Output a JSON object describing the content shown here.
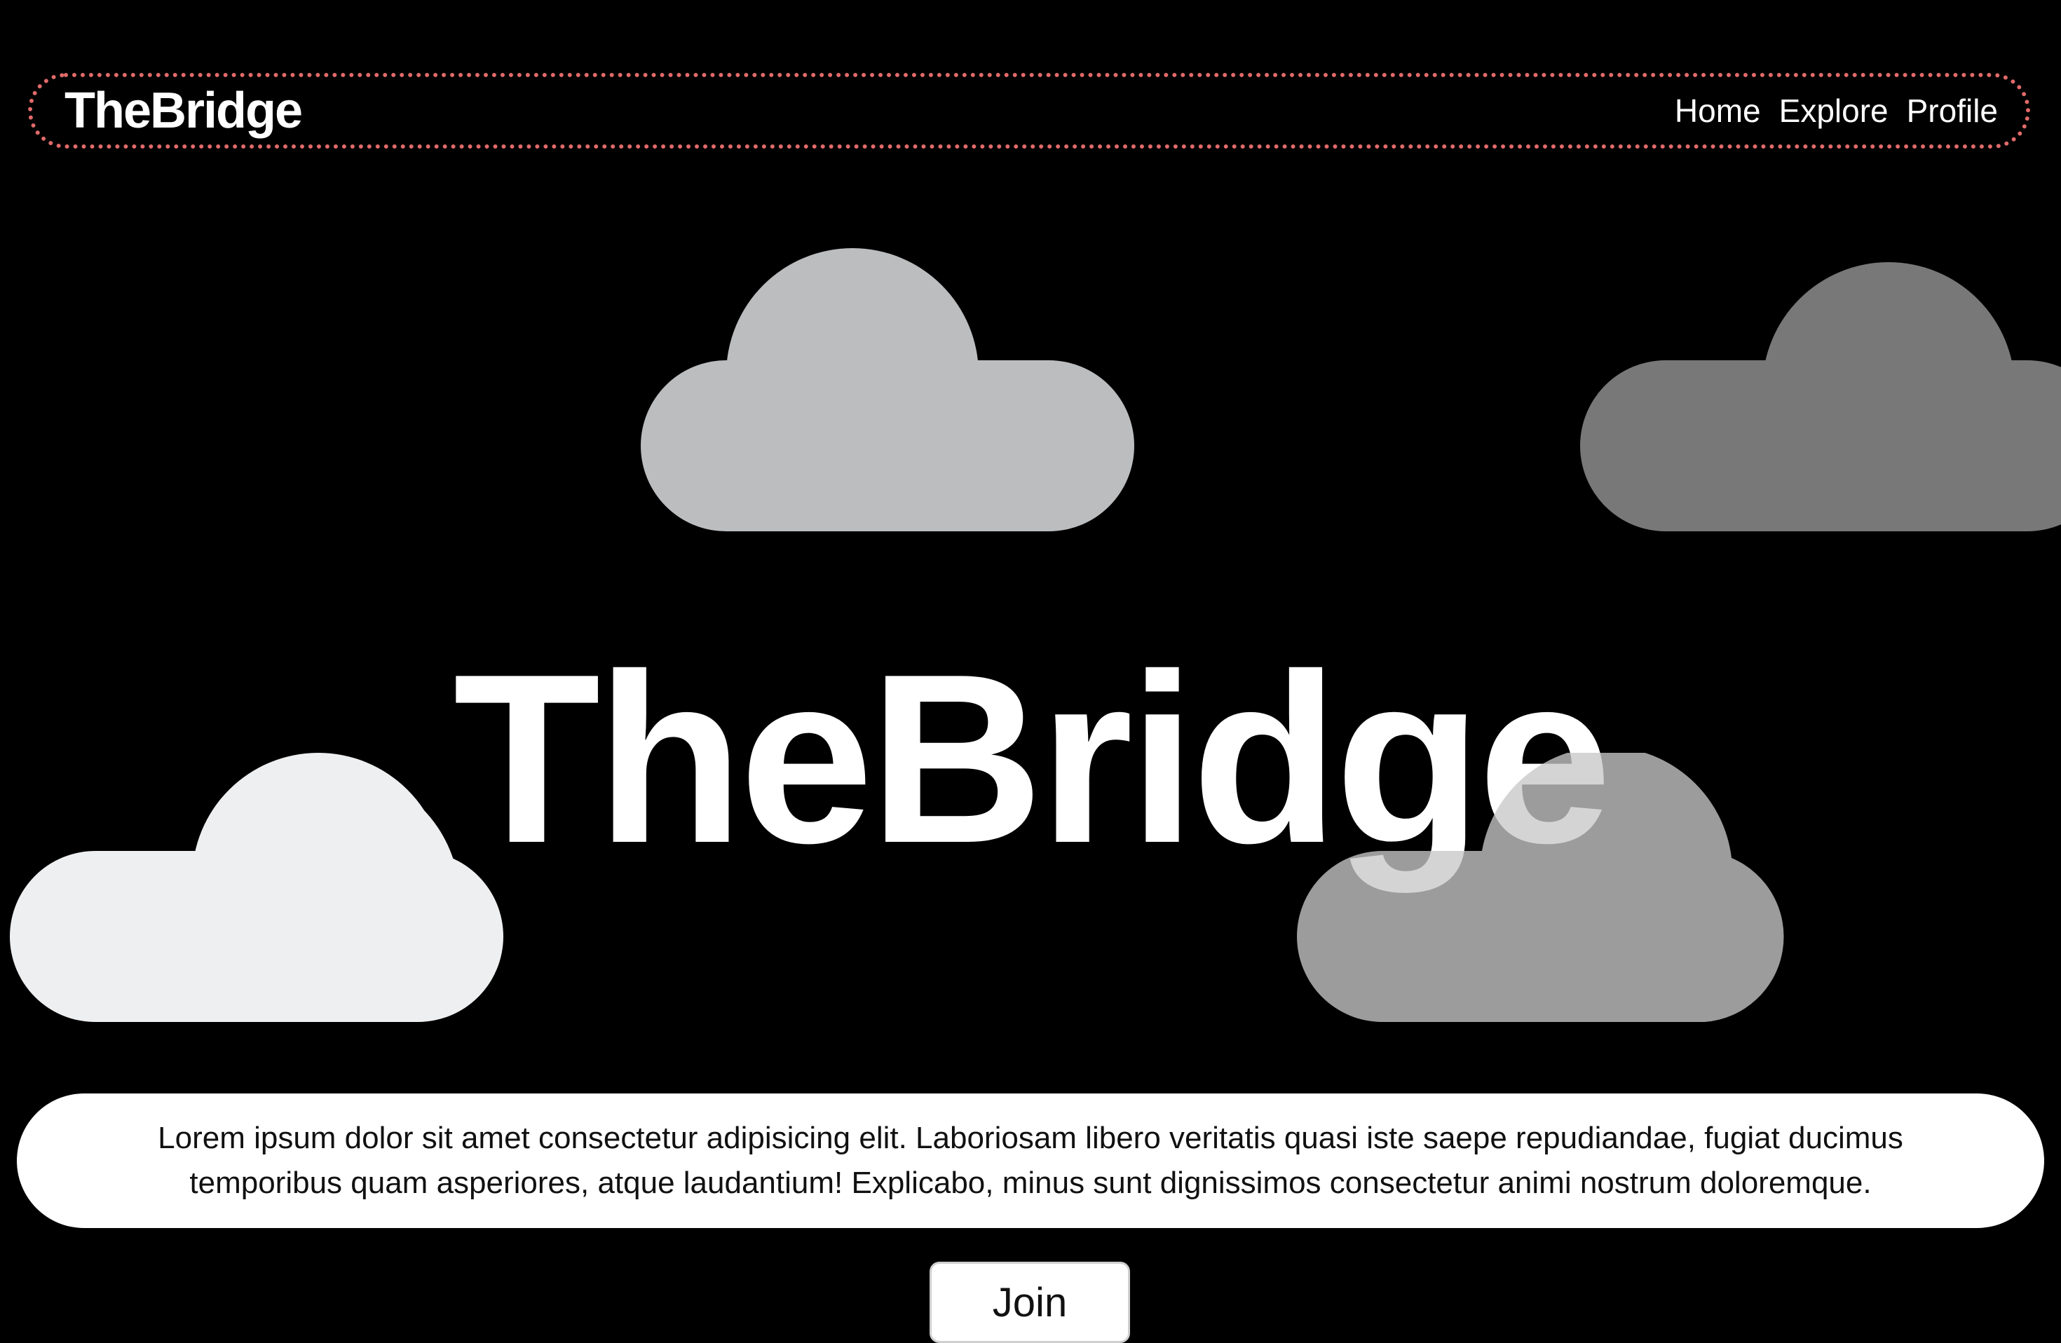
{
  "navbar": {
    "brand": "TheBridge",
    "links": [
      "Home",
      "Explore",
      "Profile"
    ]
  },
  "hero": {
    "title": "TheBridge"
  },
  "description": {
    "text": "Lorem ipsum dolor sit amet consectetur adipisicing elit. Laboriosam libero veritatis quasi iste saepe repudiandae, fugiat ducimus temporibus quam asperiores, atque laudantium! Explicabo, minus sunt dignissimos consectetur animi nostrum doloremque."
  },
  "cta": {
    "join_label": "Join"
  },
  "colors": {
    "background": "#000000",
    "nav_border": "#e26a6a",
    "cloud_light": "#eeeff0",
    "cloud_silver": "#bcbdbf",
    "cloud_gray": "#787878",
    "cloud_translucent": "#c8c8c8",
    "pill_background": "#ffffff"
  },
  "icons": [
    "cloud-icon"
  ]
}
